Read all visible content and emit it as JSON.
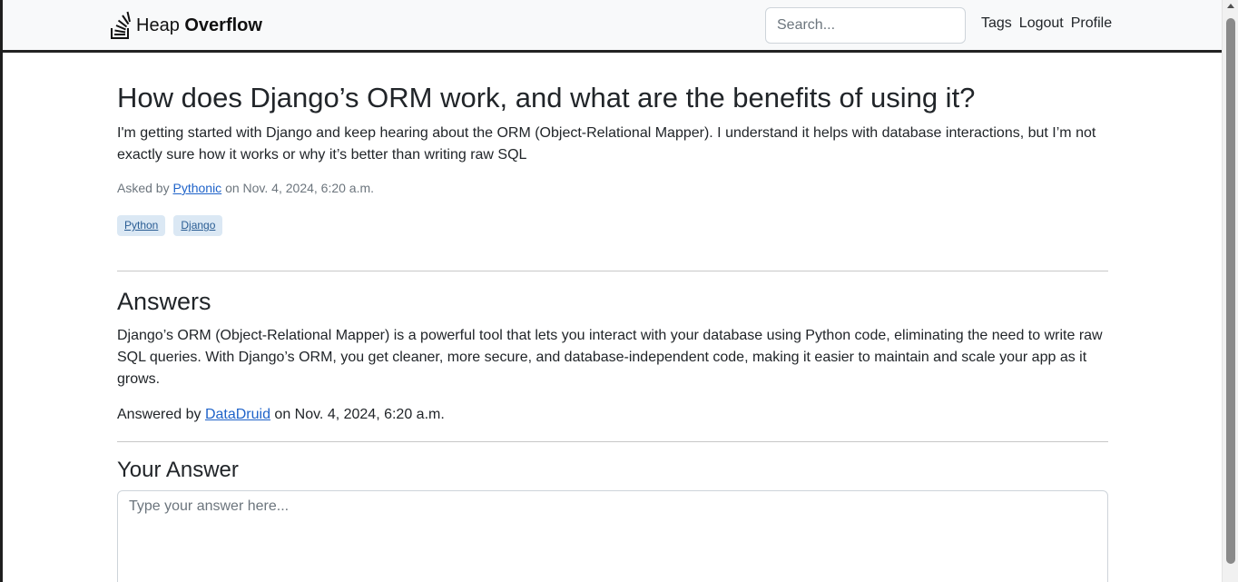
{
  "navbar": {
    "brand_light": "Heap ",
    "brand_bold": "Overflow",
    "search_placeholder": "Search...",
    "links": [
      "Tags",
      "Logout",
      "Profile"
    ]
  },
  "question": {
    "title": "How does Django’s ORM work, and what are the benefits of using it?",
    "body": "I'm getting started with Django and keep hearing about the ORM (Object-Relational Mapper). I understand it helps with database interactions, but I’m not exactly sure how it works or why it’s better than writing raw SQL",
    "asked_prefix": "Asked by ",
    "author": "Pythonic",
    "asked_suffix": " on Nov. 4, 2024, 6:20 a.m.",
    "tags": [
      "Python",
      "Django"
    ]
  },
  "answers": {
    "heading": "Answers",
    "items": [
      {
        "body": "Django’s ORM (Object-Relational Mapper) is a powerful tool that lets you interact with your database using Python code, eliminating the need to write raw SQL queries. With Django’s ORM, you get cleaner, more secure, and database-independent code, making it easier to maintain and scale your app as it grows.",
        "prefix": "Answered by ",
        "author": "DataDruid",
        "suffix": " on Nov. 4, 2024, 6:20 a.m."
      }
    ]
  },
  "your_answer": {
    "heading": "Your Answer",
    "placeholder": "Type your answer here..."
  }
}
